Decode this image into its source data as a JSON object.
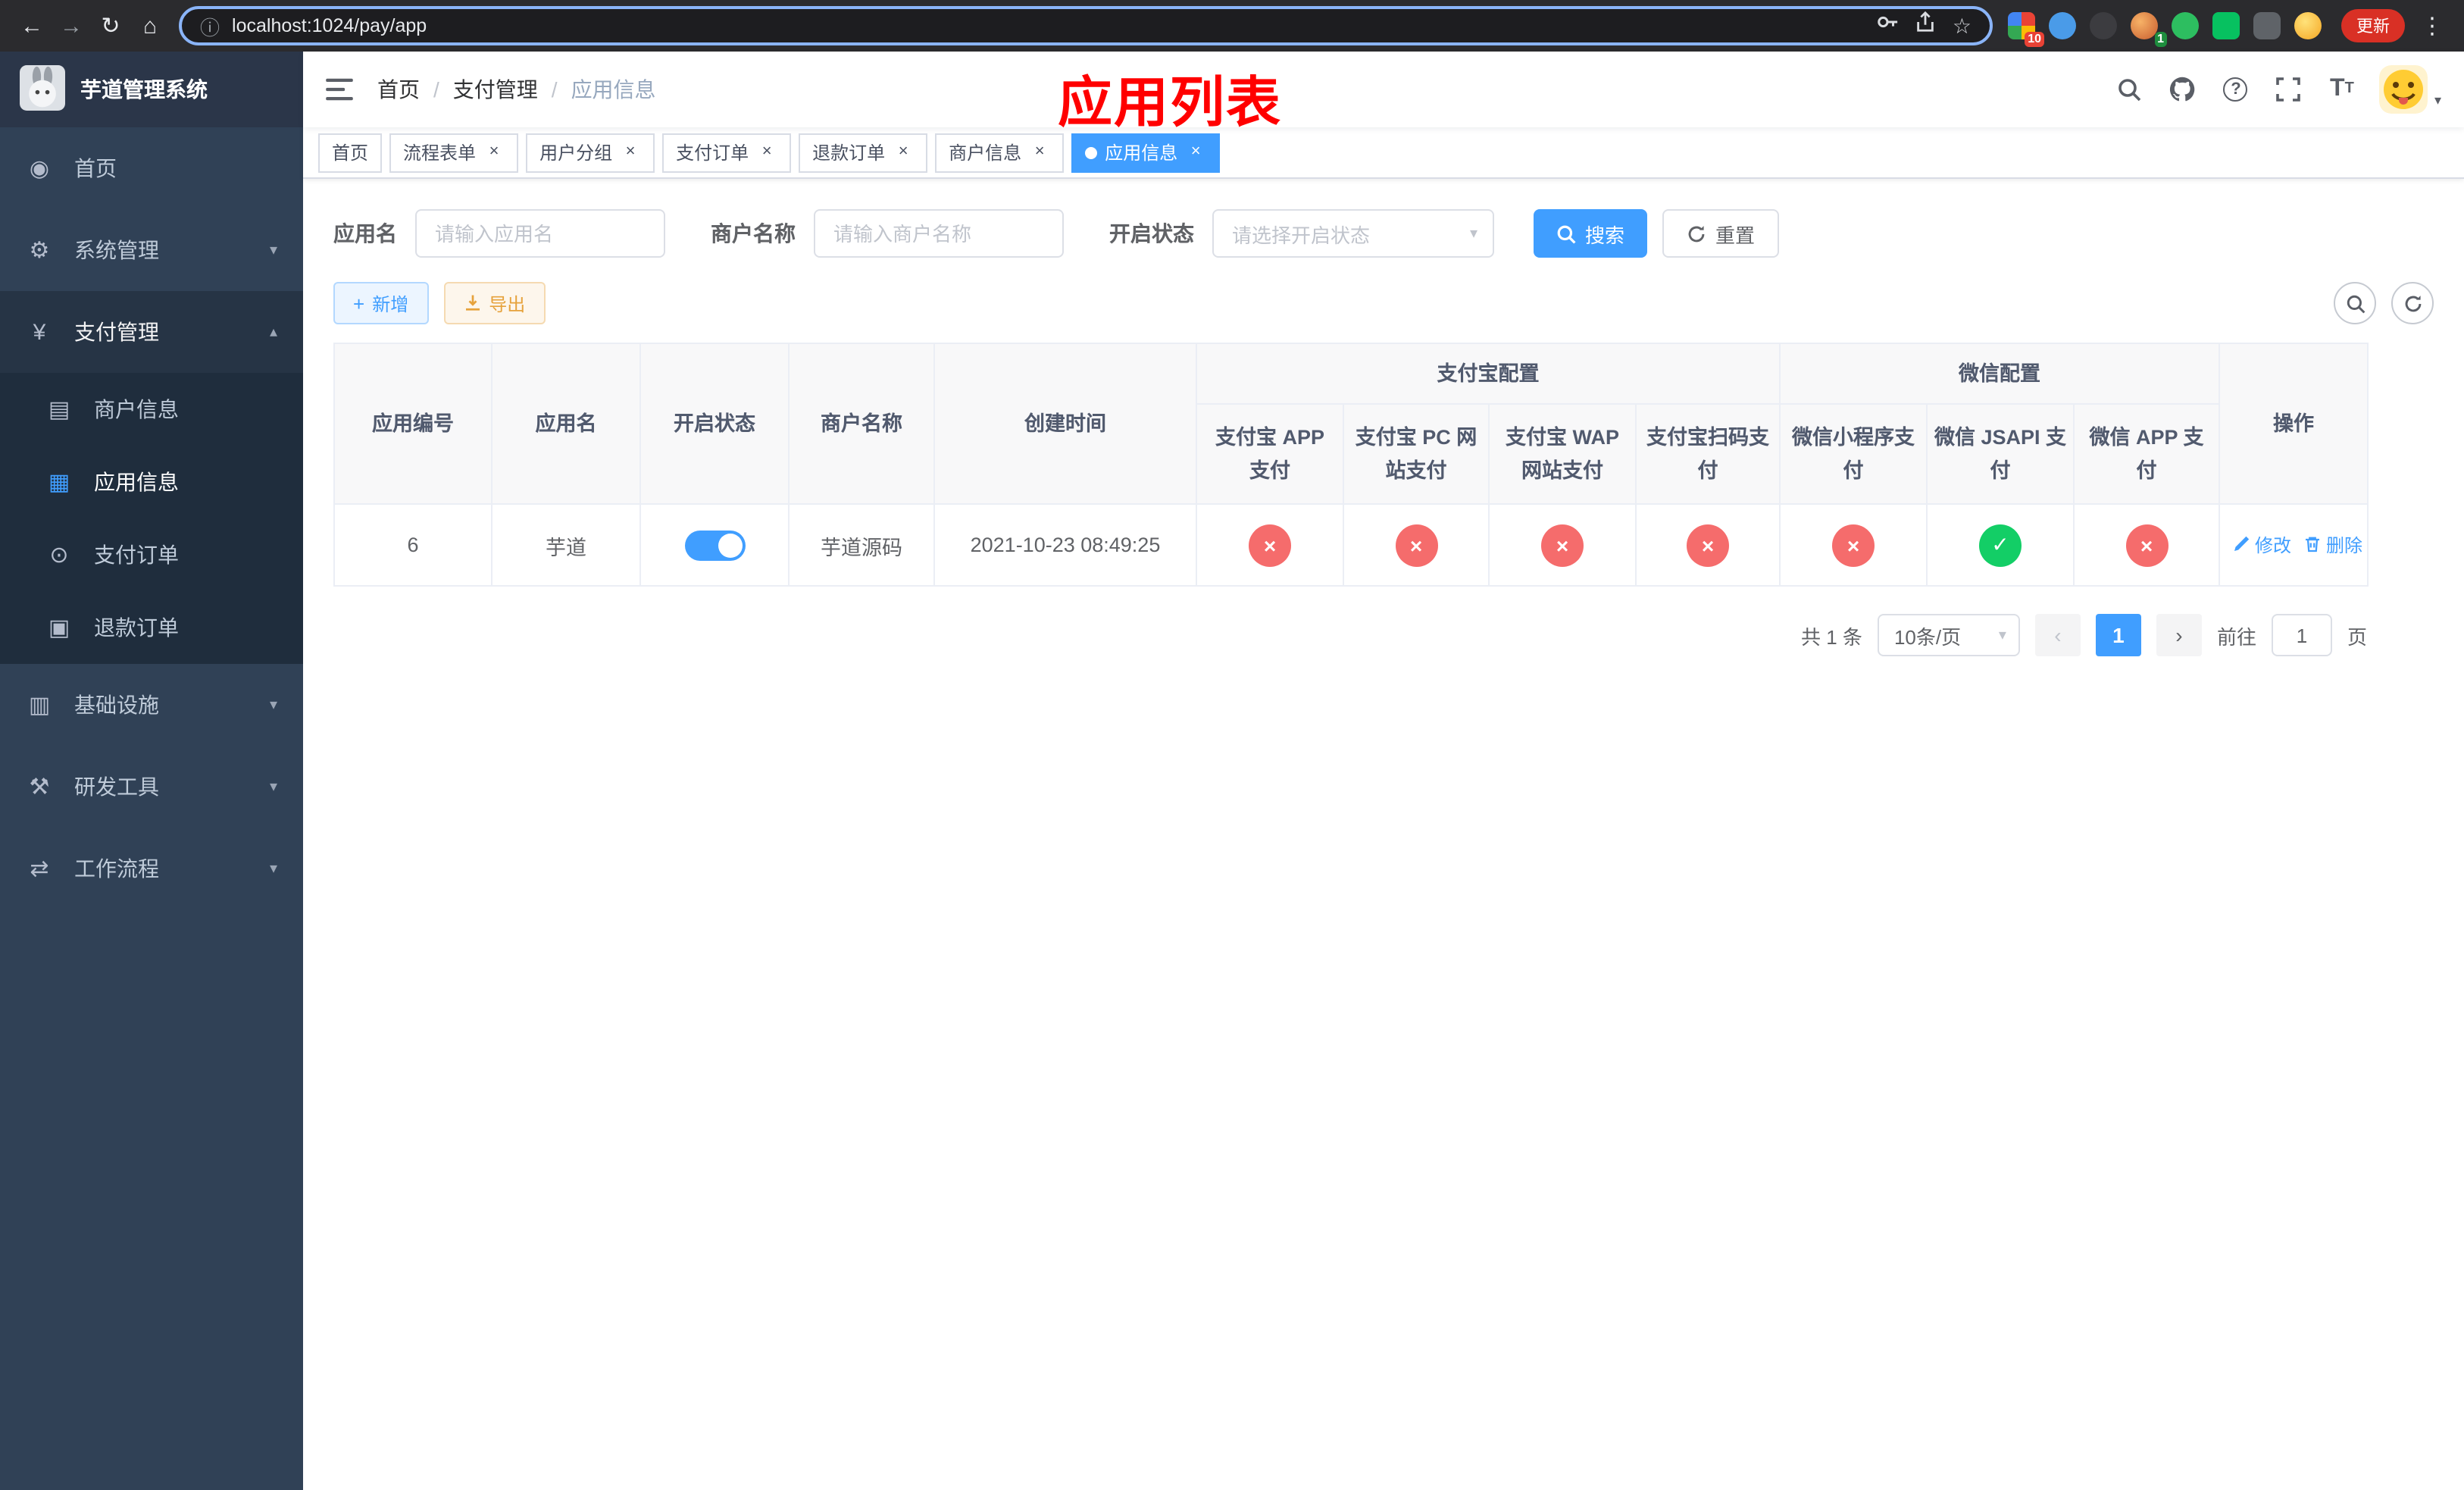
{
  "colors": {
    "accent": "#409eff",
    "danger": "#f56c6c",
    "success": "#13ce66",
    "warning": "#e6a23c",
    "sidebar_bg": "#304156",
    "annotation": "#ff0000"
  },
  "browser": {
    "url": "localhost:1024/pay/app",
    "update_label": "更新",
    "extension_badge_1": "10",
    "extension_badge_2": "1"
  },
  "sidebar": {
    "title": "芋道管理系统",
    "items": [
      {
        "label": "首页"
      },
      {
        "label": "系统管理"
      },
      {
        "label": "支付管理",
        "children": [
          {
            "label": "商户信息"
          },
          {
            "label": "应用信息"
          },
          {
            "label": "支付订单"
          },
          {
            "label": "退款订单"
          }
        ]
      },
      {
        "label": "基础设施"
      },
      {
        "label": "研发工具"
      },
      {
        "label": "工作流程"
      }
    ]
  },
  "header": {
    "breadcrumb": [
      "首页",
      "支付管理",
      "应用信息"
    ],
    "annotation": "应用列表"
  },
  "tabs": [
    {
      "label": "首页"
    },
    {
      "label": "流程表单"
    },
    {
      "label": "用户分组"
    },
    {
      "label": "支付订单"
    },
    {
      "label": "退款订单"
    },
    {
      "label": "商户信息"
    },
    {
      "label": "应用信息"
    }
  ],
  "filters": {
    "app_name_label": "应用名",
    "app_name_placeholder": "请输入应用名",
    "merchant_label": "商户名称",
    "merchant_placeholder": "请输入商户名称",
    "status_label": "开启状态",
    "status_placeholder": "请选择开启状态",
    "search_label": "搜索",
    "reset_label": "重置"
  },
  "toolbar": {
    "add_label": "新增",
    "export_label": "导出"
  },
  "table": {
    "groups": {
      "alipay": "支付宝配置",
      "wechat": "微信配置"
    },
    "columns": [
      "应用编号",
      "应用名",
      "开启状态",
      "商户名称",
      "创建时间",
      "支付宝 APP 支付",
      "支付宝 PC 网站支付",
      "支付宝 WAP 网站支付",
      "支付宝扫码支付",
      "微信小程序支付",
      "微信 JSAPI 支付",
      "微信 APP 支付",
      "操作"
    ],
    "rows": [
      {
        "id": "6",
        "name": "芋道",
        "enabled": true,
        "merchant": "芋道源码",
        "created": "2021-10-23 08:49:25",
        "alipay_app": false,
        "alipay_pc": false,
        "alipay_wap": false,
        "alipay_scan": false,
        "wechat_mini": false,
        "wechat_jsapi": true,
        "wechat_app": false,
        "edit_label": "修改",
        "delete_label": "删除"
      }
    ]
  },
  "pagination": {
    "total_label": "共 1 条",
    "page_size_label": "10条/页",
    "current_page": "1",
    "goto_label": "前往",
    "goto_value": "1",
    "page_unit": "页"
  }
}
